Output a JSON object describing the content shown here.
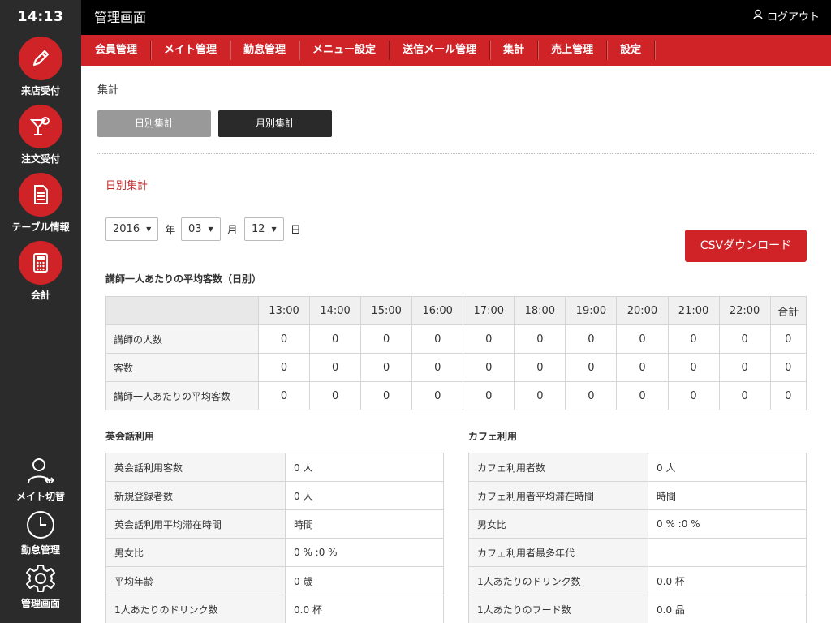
{
  "sidebar": {
    "clock": "14:13",
    "buttons": [
      {
        "label": "来店受付",
        "icon": "pencil-icon"
      },
      {
        "label": "注文受付",
        "icon": "cocktail-icon"
      },
      {
        "label": "テーブル情報",
        "icon": "document-icon"
      },
      {
        "label": "会計",
        "icon": "calculator-icon"
      }
    ],
    "bottom": [
      {
        "label": "メイト切替",
        "icon": "user-switch-icon"
      },
      {
        "label": "勤怠管理",
        "icon": "clock-icon"
      },
      {
        "label": "管理画面",
        "icon": "gear-icon"
      }
    ]
  },
  "header": {
    "title": "管理画面",
    "logout": "ログアウト"
  },
  "nav": [
    "会員管理",
    "メイト管理",
    "勤怠管理",
    "メニュー設定",
    "送信メール管理",
    "集計",
    "売上管理",
    "設定"
  ],
  "breadcrumb": "集計",
  "tabs": {
    "daily": "日別集計",
    "monthly": "月別集計"
  },
  "section_title": "日別集計",
  "date": {
    "year": "2016",
    "year_unit": "年",
    "month": "03",
    "month_unit": "月",
    "day": "12",
    "day_unit": "日"
  },
  "csv_button": "CSVダウンロード",
  "hourly_table": {
    "title": "講師一人あたりの平均客数（日別）",
    "columns": [
      "13:00",
      "14:00",
      "15:00",
      "16:00",
      "17:00",
      "18:00",
      "19:00",
      "20:00",
      "21:00",
      "22:00",
      "合計"
    ],
    "rows": [
      {
        "label": "講師の人数",
        "values": [
          "0",
          "0",
          "0",
          "0",
          "0",
          "0",
          "0",
          "0",
          "0",
          "0",
          "0"
        ]
      },
      {
        "label": "客数",
        "values": [
          "0",
          "0",
          "0",
          "0",
          "0",
          "0",
          "0",
          "0",
          "0",
          "0",
          "0"
        ]
      },
      {
        "label": "講師一人あたりの平均客数",
        "values": [
          "0",
          "0",
          "0",
          "0",
          "0",
          "0",
          "0",
          "0",
          "0",
          "0",
          "0"
        ]
      }
    ]
  },
  "english": {
    "title": "英会話利用",
    "rows": [
      {
        "k": "英会話利用客数",
        "v": "0 人"
      },
      {
        "k": "新規登録者数",
        "v": "0 人"
      },
      {
        "k": "英会話利用平均滞在時間",
        "v": "時間"
      },
      {
        "k": "男女比",
        "v": "0 % :0 %"
      },
      {
        "k": "平均年齢",
        "v": "0 歳"
      },
      {
        "k": "1人あたりのドリンク数",
        "v": "0.0 杯"
      }
    ]
  },
  "cafe": {
    "title": "カフェ利用",
    "rows": [
      {
        "k": "カフェ利用者数",
        "v": "0 人"
      },
      {
        "k": "カフェ利用者平均滞在時間",
        "v": "時間"
      },
      {
        "k": "男女比",
        "v": "0 % :0 %"
      },
      {
        "k": "カフェ利用者最多年代",
        "v": ""
      },
      {
        "k": "1人あたりのドリンク数",
        "v": "0.0 杯"
      },
      {
        "k": "1人あたりのフード数",
        "v": "0.0 品"
      }
    ]
  },
  "colors": {
    "accent": "#cf2327",
    "sidebar": "#2b2b2b",
    "topbar": "#000000"
  }
}
